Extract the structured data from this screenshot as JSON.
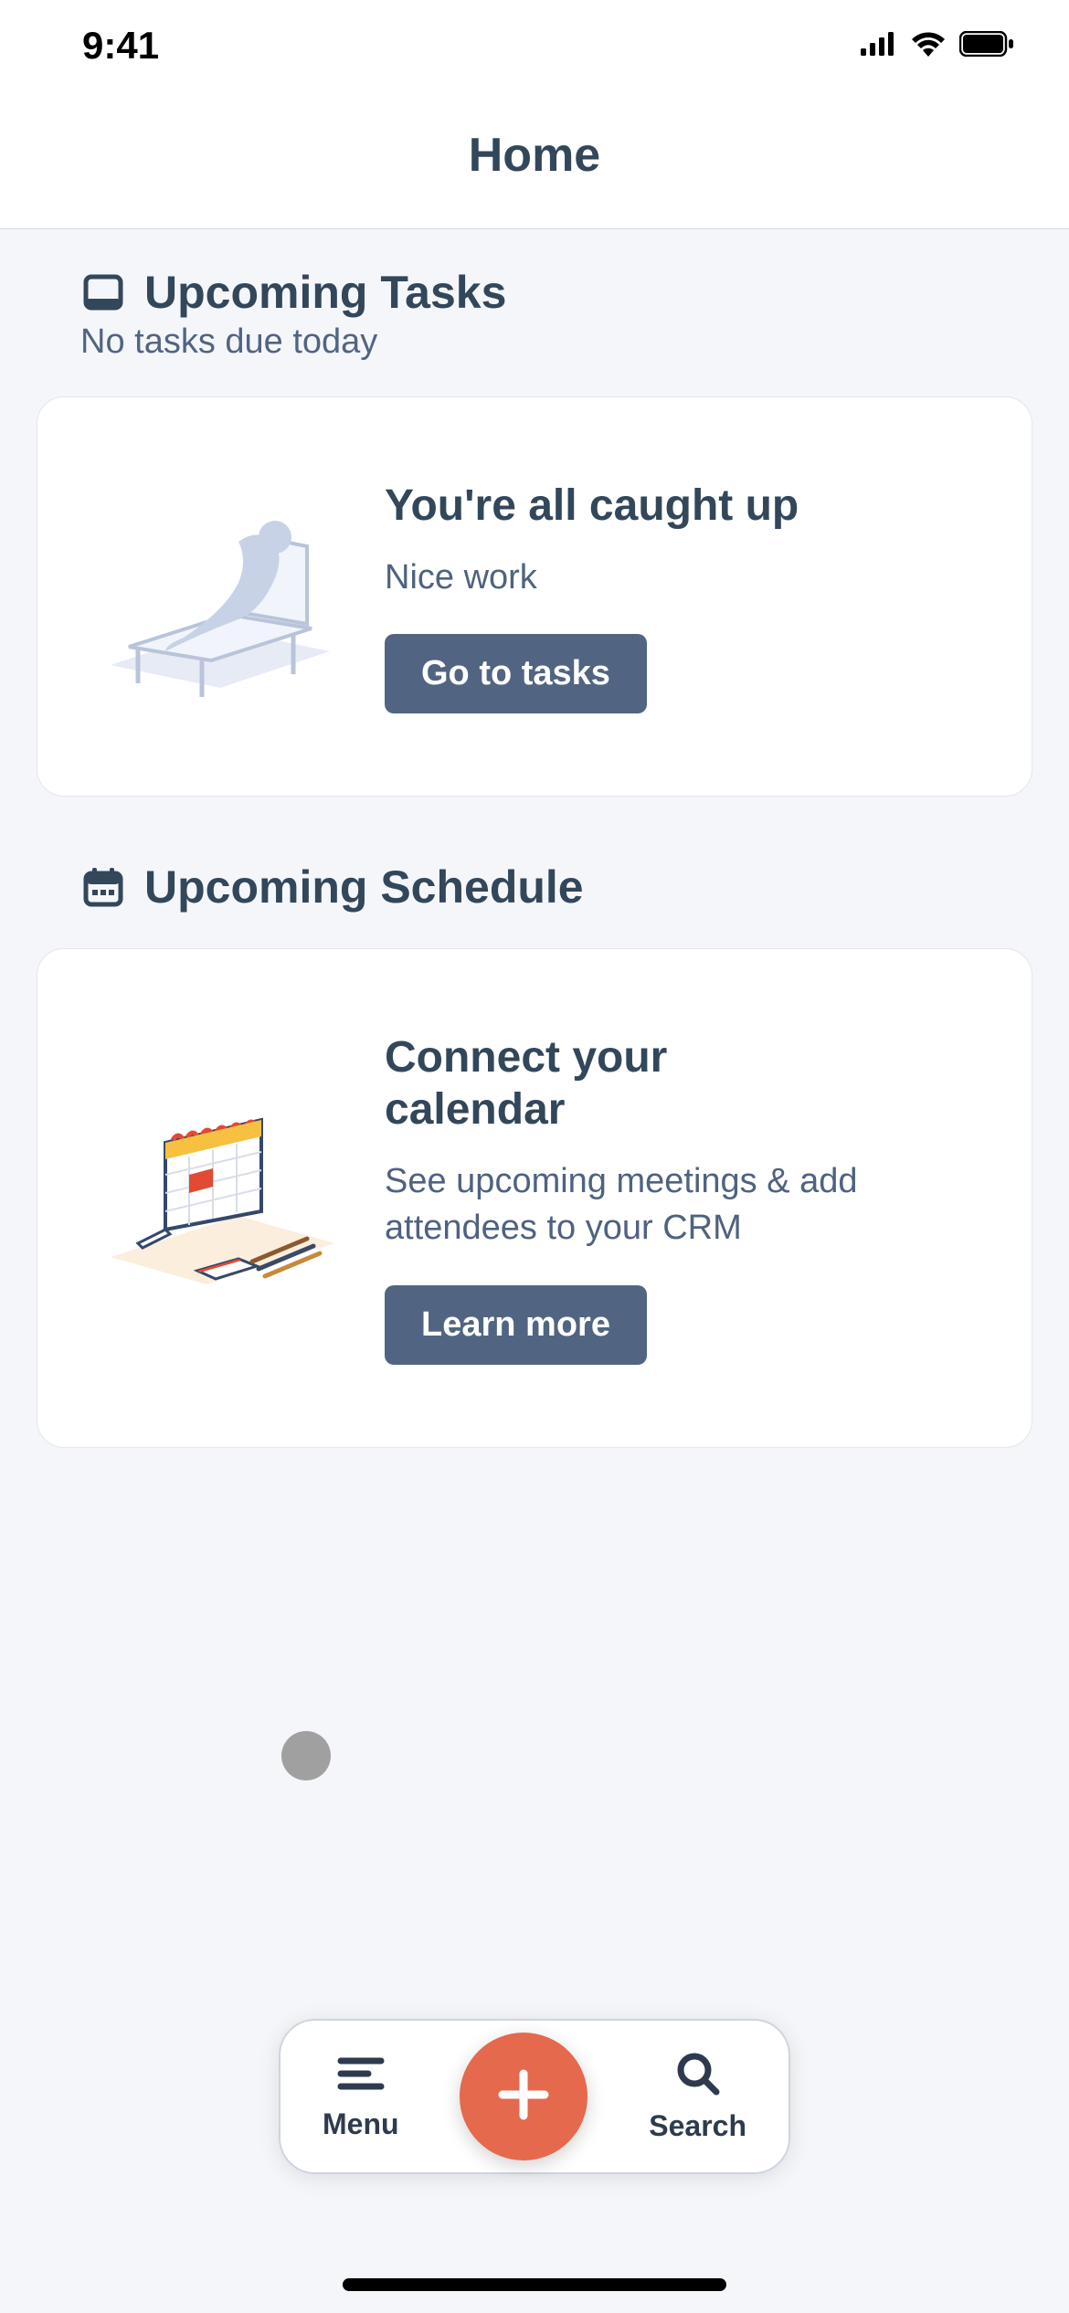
{
  "status": {
    "time": "9:41"
  },
  "nav": {
    "title": "Home"
  },
  "tasks": {
    "title": "Upcoming Tasks",
    "subtitle": "No tasks due today",
    "card": {
      "title": "You're all caught up",
      "subtitle": "Nice work",
      "button": "Go to tasks"
    }
  },
  "schedule": {
    "title": "Upcoming Schedule",
    "card": {
      "title": "Connect your calendar",
      "subtitle": "See upcoming meetings & add attendees to your CRM",
      "button": "Learn more"
    }
  },
  "dock": {
    "menu": "Menu",
    "search": "Search"
  }
}
